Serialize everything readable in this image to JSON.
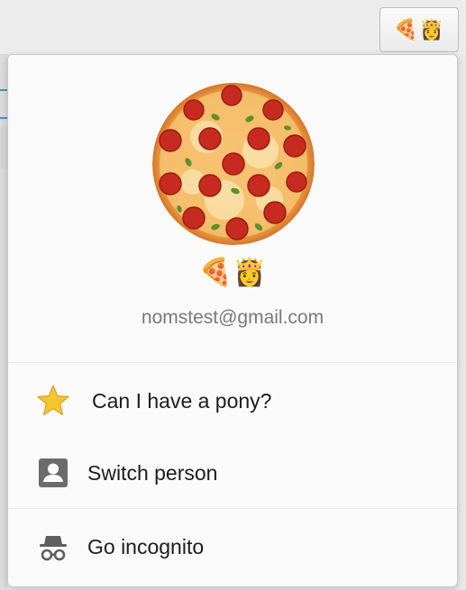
{
  "toolbar": {
    "avatar_button_label": "🍕👸"
  },
  "profile": {
    "name": "🍕👸",
    "email": "nomstest@gmail.com"
  },
  "menu": {
    "items": [
      {
        "label": "Can I have a pony?",
        "icon": "star-icon"
      },
      {
        "label": "Switch person",
        "icon": "person-icon"
      },
      {
        "label": "Go incognito",
        "icon": "incognito-icon"
      }
    ]
  },
  "colors": {
    "menu_background": "#fafafa",
    "separator": "#eaeaea",
    "email_text": "#7a7a7a",
    "star": "#f6c530"
  }
}
